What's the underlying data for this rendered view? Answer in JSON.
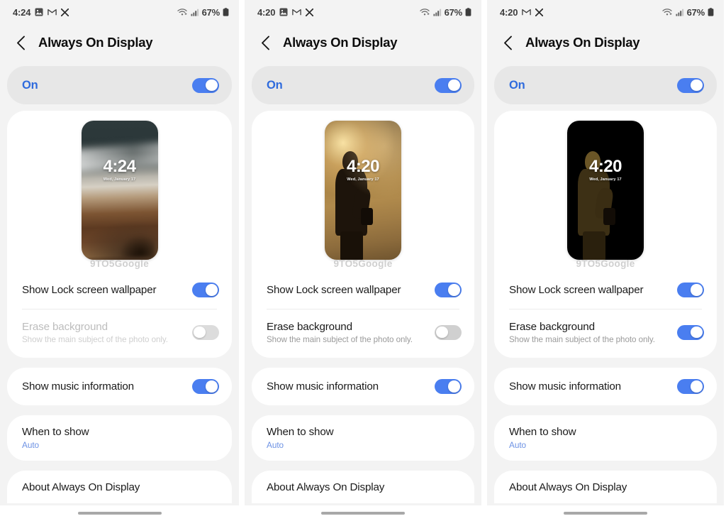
{
  "panels": [
    {
      "statusbar": {
        "time": "4:24",
        "icons": [
          "photos-icon",
          "gmail-icon",
          "x-icon"
        ],
        "wifi_icon": "wifi-icon",
        "signal_icon": "cellular-signal-icon",
        "battery_percent": "67%",
        "battery_icon": "battery-icon"
      },
      "header": {
        "back_icon": "back-chevron-icon",
        "title": "Always On Display"
      },
      "master": {
        "label": "On",
        "toggle": "on"
      },
      "preview": {
        "wallpaper": "aerial-shoreline-photo",
        "clock": "4:24",
        "date": "Wed, January 17",
        "watermark": "9TO5Google"
      },
      "rows": [
        {
          "title": "Show Lock screen wallpaper",
          "sub": "",
          "toggle": "on",
          "disabled": false
        },
        {
          "title": "Erase background",
          "sub": "Show the main subject of the photo only.",
          "toggle": "off",
          "disabled": true
        },
        {
          "title": "Show music information",
          "sub": "",
          "toggle": "on",
          "disabled": false
        },
        {
          "title": "When to show",
          "sub": "Auto",
          "toggle": "none",
          "disabled": false
        },
        {
          "title": "About Always On Display",
          "sub": "",
          "toggle": "none",
          "disabled": false
        }
      ]
    },
    {
      "statusbar": {
        "time": "4:20",
        "icons": [
          "photos-icon",
          "gmail-icon",
          "x-icon"
        ],
        "wifi_icon": "wifi-icon",
        "signal_icon": "cellular-signal-icon",
        "battery_percent": "67%",
        "battery_icon": "battery-icon"
      },
      "header": {
        "back_icon": "back-chevron-icon",
        "title": "Always On Display"
      },
      "master": {
        "label": "On",
        "toggle": "on"
      },
      "preview": {
        "wallpaper": "photographer-sunset-photo",
        "clock": "4:20",
        "date": "Wed, January 17",
        "watermark": "9TO5Google"
      },
      "rows": [
        {
          "title": "Show Lock screen wallpaper",
          "sub": "",
          "toggle": "on",
          "disabled": false
        },
        {
          "title": "Erase background",
          "sub": "Show the main subject of the photo only.",
          "toggle": "off",
          "disabled": false
        },
        {
          "title": "Show music information",
          "sub": "",
          "toggle": "on",
          "disabled": false
        },
        {
          "title": "When to show",
          "sub": "Auto",
          "toggle": "none",
          "disabled": false
        },
        {
          "title": "About Always On Display",
          "sub": "",
          "toggle": "none",
          "disabled": false
        }
      ]
    },
    {
      "statusbar": {
        "time": "4:20",
        "icons": [
          "gmail-icon",
          "x-icon"
        ],
        "wifi_icon": "wifi-icon",
        "signal_icon": "cellular-signal-icon",
        "battery_percent": "67%",
        "battery_icon": "battery-icon"
      },
      "header": {
        "back_icon": "back-chevron-icon",
        "title": "Always On Display"
      },
      "master": {
        "label": "On",
        "toggle": "on"
      },
      "preview": {
        "wallpaper": "photographer-erased-background",
        "clock": "4:20",
        "date": "Wed, January 17",
        "watermark": "9TO5Google"
      },
      "rows": [
        {
          "title": "Show Lock screen wallpaper",
          "sub": "",
          "toggle": "on",
          "disabled": false
        },
        {
          "title": "Erase background",
          "sub": "Show the main subject of the photo only.",
          "toggle": "on",
          "disabled": false
        },
        {
          "title": "Show music information",
          "sub": "",
          "toggle": "on",
          "disabled": false
        },
        {
          "title": "When to show",
          "sub": "Auto",
          "toggle": "none",
          "disabled": false
        },
        {
          "title": "About Always On Display",
          "sub": "",
          "toggle": "none",
          "disabled": false
        }
      ]
    }
  ],
  "colors": {
    "accent_blue": "#4a7ef0",
    "master_label_blue": "#2f6bdd",
    "page_background": "#f3f3f3",
    "card_background": "#ffffff",
    "master_card_background": "#e7e7e7",
    "toggle_off": "#d0d0d0",
    "sub_auto_blue": "#6d92e4"
  }
}
